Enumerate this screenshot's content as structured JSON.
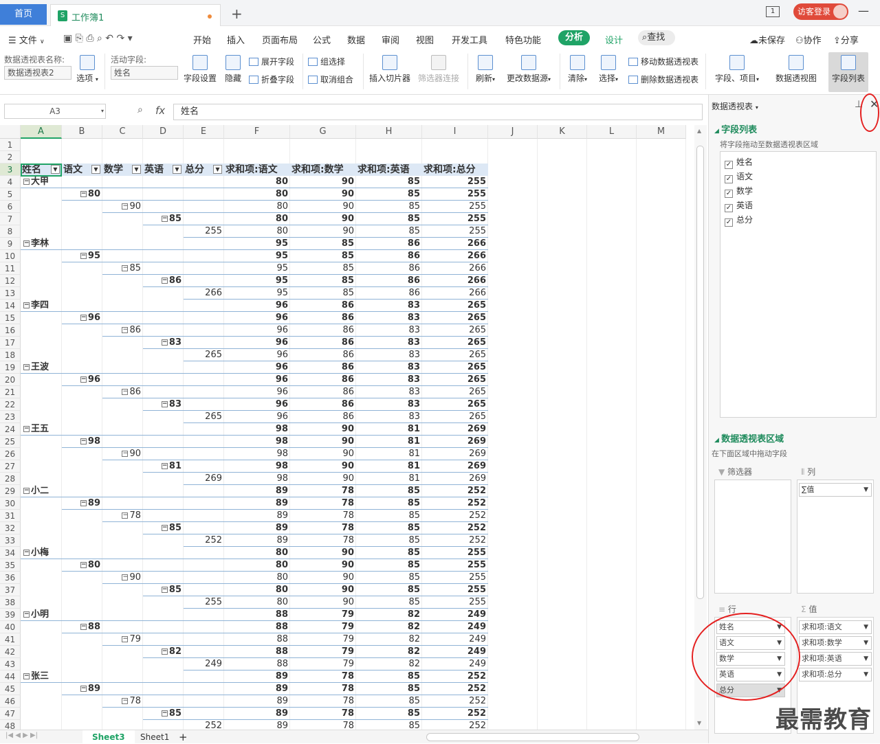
{
  "titlebar": {
    "home_tab": "首页",
    "doc_tab": "工作簿1",
    "doc_icon": "S",
    "new_tab": "+",
    "page_badge": "1",
    "login": "访客登录"
  },
  "menubar": {
    "file": "文件",
    "items": [
      "开始",
      "插入",
      "页面布局",
      "公式",
      "数据",
      "审阅",
      "视图",
      "开发工具",
      "特色功能"
    ],
    "active": "分析",
    "design": "设计",
    "search": "查找",
    "unsaved": "未保存",
    "collab": "协作",
    "share": "分享"
  },
  "ribbon": {
    "pt_name_label": "数据透视表名称:",
    "pt_name_value": "数据透视表2",
    "options": "选项",
    "active_field_label": "活动字段:",
    "active_field_value": "姓名",
    "field_settings": "字段设置",
    "hide": "隐藏",
    "expand": "展开字段",
    "collapse": "折叠字段",
    "group_sel": "组选择",
    "ungroup": "取消组合",
    "insert_slicer": "插入切片器",
    "filter_conn": "筛选器连接",
    "refresh": "刷新",
    "change_source": "更改数据源",
    "clear": "清除",
    "select": "选择",
    "move_pt": "移动数据透视表",
    "delete_pt": "删除数据透视表",
    "fields_items": "字段、项目",
    "pivot_chart": "数据透视图",
    "field_list": "字段列表"
  },
  "formula": {
    "namebox": "A3",
    "fx": "fx",
    "content": "姓名"
  },
  "columns": [
    "A",
    "B",
    "C",
    "D",
    "E",
    "F",
    "G",
    "H",
    "I",
    "J",
    "K",
    "L",
    "M"
  ],
  "rows": [
    "1",
    "2",
    "3",
    "4",
    "5",
    "6",
    "7",
    "8",
    "9",
    "10",
    "11",
    "12",
    "13",
    "14",
    "15",
    "16",
    "17",
    "18",
    "19",
    "20",
    "21",
    "22",
    "23",
    "24",
    "25",
    "26",
    "27",
    "28",
    "29",
    "30",
    "31",
    "32",
    "33",
    "34",
    "35",
    "36",
    "37",
    "38",
    "39",
    "40",
    "41",
    "42",
    "43",
    "44",
    "45",
    "46",
    "47",
    "48"
  ],
  "pivot_headers": [
    "姓名",
    "语文",
    "数学",
    "英语",
    "总分",
    "求和项:语文",
    "求和项:数学",
    "求和项:英语",
    "求和项:总分"
  ],
  "pivot_groups": [
    {
      "name": "大甲",
      "yw": "80",
      "sx": "90",
      "yy": "85",
      "zf": "255"
    },
    {
      "name": "李林",
      "yw": "95",
      "sx": "85",
      "yy": "86",
      "zf": "266"
    },
    {
      "name": "李四",
      "yw": "96",
      "sx": "86",
      "yy": "83",
      "zf": "265"
    },
    {
      "name": "王波",
      "yw": "96",
      "sx": "86",
      "yy": "83",
      "zf": "265"
    },
    {
      "name": "王五",
      "yw": "98",
      "sx": "90",
      "yy": "81",
      "zf": "269"
    },
    {
      "name": "小二",
      "yw": "89",
      "sx": "78",
      "yy": "85",
      "zf": "252"
    },
    {
      "name": "小梅",
      "yw": "80",
      "sx": "90",
      "yy": "85",
      "zf": "255"
    },
    {
      "name": "小明",
      "yw": "88",
      "sx": "79",
      "yy": "82",
      "zf": "249"
    },
    {
      "name": "张三",
      "yw": "89",
      "sx": "78",
      "yy": "85",
      "zf": "252"
    }
  ],
  "sheets": {
    "active": "Sheet3",
    "other": "Sheet1",
    "add": "+"
  },
  "panel": {
    "title": "数据透视表",
    "field_list": "字段列表",
    "drag_hint": "将字段拖动至数据透视表区域",
    "fields": [
      "姓名",
      "语文",
      "数学",
      "英语",
      "总分"
    ],
    "areas_title": "数据透视表区域",
    "areas_hint": "在下面区域中拖动字段",
    "filter": "筛选器",
    "columns": "列",
    "col_item": "∑值",
    "rows": "行",
    "values": "值",
    "row_items": [
      "姓名",
      "语文",
      "数学",
      "英语",
      "总分"
    ],
    "value_items": [
      "求和项:语文",
      "求和项:数学",
      "求和项:英语",
      "求和项:总分"
    ]
  },
  "watermark": "最需教育",
  "colors": {
    "accent": "#1fa366",
    "home_tab": "#3f7fd9",
    "login": "#e04a3a",
    "annotation": "#e42020"
  }
}
